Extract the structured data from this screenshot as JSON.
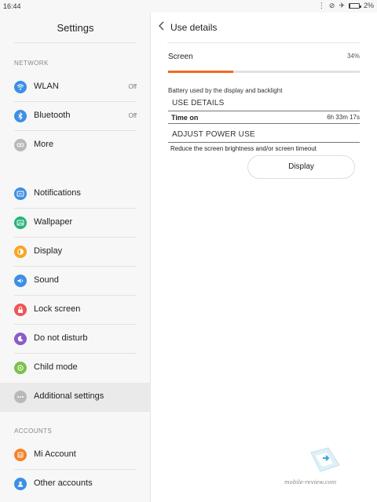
{
  "status": {
    "time": "16:44",
    "battery": "2%",
    "battery_level": 0.02
  },
  "settings": {
    "title": "Settings",
    "sections": {
      "network": "NETWORK",
      "accounts": "ACCOUNTS"
    },
    "items": [
      {
        "label": "WLAN",
        "value": "Off",
        "icon": "wifi-icon",
        "color": "#3d8fe6"
      },
      {
        "label": "Bluetooth",
        "value": "Off",
        "icon": "bluetooth-icon",
        "color": "#3d8fe6"
      },
      {
        "label": "More",
        "value": "",
        "icon": "more-icon",
        "color": "#b9b9b9"
      },
      {
        "label": "Notifications",
        "value": "",
        "icon": "notifications-icon",
        "color": "#3d8fe6"
      },
      {
        "label": "Wallpaper",
        "value": "",
        "icon": "wallpaper-icon",
        "color": "#27b37a"
      },
      {
        "label": "Display",
        "value": "",
        "icon": "display-icon",
        "color": "#f5a623"
      },
      {
        "label": "Sound",
        "value": "",
        "icon": "sound-icon",
        "color": "#3d8fe6"
      },
      {
        "label": "Lock screen",
        "value": "",
        "icon": "lock-icon",
        "color": "#ee5555"
      },
      {
        "label": "Do not disturb",
        "value": "",
        "icon": "moon-icon",
        "color": "#8a5bc9"
      },
      {
        "label": "Child mode",
        "value": "",
        "icon": "child-mode-icon",
        "color": "#7cc04a"
      },
      {
        "label": "Additional settings",
        "value": "",
        "icon": "additional-settings-icon",
        "color": "#b9b9b9"
      },
      {
        "label": "Mi Account",
        "value": "",
        "icon": "mi-account-icon",
        "color": "#f5822a"
      },
      {
        "label": "Other accounts",
        "value": "",
        "icon": "accounts-icon",
        "color": "#3d8fe6"
      }
    ]
  },
  "detail": {
    "title": "Use details",
    "item_label": "Screen",
    "percent": "34%",
    "percent_value": 0.34,
    "description": "Battery used by the display and backlight",
    "use_details_heading": "USE DETAILS",
    "time_on_label": "Time on",
    "time_on_value": "6h 33m 17s",
    "adjust_heading": "ADJUST POWER USE",
    "hint": "Reduce the screen brightness and/or screen timeout",
    "display_button": "Display",
    "accent": "#f06a22"
  },
  "watermark": {
    "text": "mobile-review.com"
  }
}
